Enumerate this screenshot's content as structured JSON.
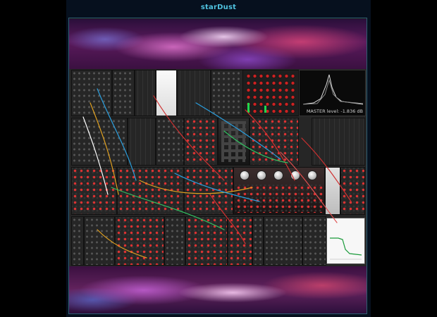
{
  "window": {
    "title": "starDust"
  },
  "rack": {
    "master_display": {
      "label": "MASTER level: -1.836 dB"
    }
  }
}
